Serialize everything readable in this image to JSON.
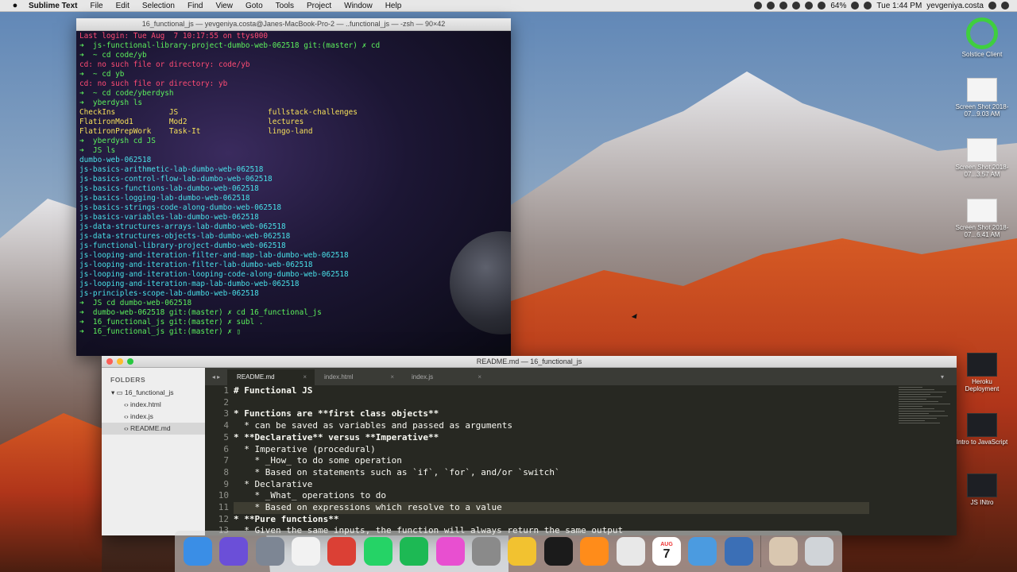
{
  "menubar": {
    "app": "Sublime Text",
    "items": [
      "File",
      "Edit",
      "Selection",
      "Find",
      "View",
      "Goto",
      "Tools",
      "Project",
      "Window",
      "Help"
    ],
    "battery": "64%",
    "clock": "Tue 1:44 PM",
    "user": "yevgeniya.costa"
  },
  "terminal": {
    "title": "16_functional_js — yevgeniya.costa@Janes-MacBook-Pro-2 — ..functional_js — -zsh — 90×42",
    "lines": [
      {
        "t": "Last login: Tue Aug  7 10:17:55 on ttys000",
        "c": "l-red"
      },
      {
        "t": "➜  js-functional-library-project-dumbo-web-062518 git:(master) ✗ cd",
        "c": "l-green"
      },
      {
        "t": "➜  ~ cd code/yb",
        "c": "l-green"
      },
      {
        "t": "cd: no such file or directory: code/yb",
        "c": "l-red"
      },
      {
        "t": "➜  ~ cd yb",
        "c": "l-green"
      },
      {
        "t": "cd: no such file or directory: yb",
        "c": "l-red"
      },
      {
        "t": "➜  ~ cd code/yberdysh",
        "c": "l-green"
      },
      {
        "t": "➜  yberdysh ls",
        "c": "l-green"
      },
      {
        "t": "CheckIns            JS                    fullstack-challenges",
        "c": "l-yel"
      },
      {
        "t": "FlatironMod1        Mod2                  lectures",
        "c": "l-yel"
      },
      {
        "t": "FlatironPrepWork    Task-It               lingo-land",
        "c": "l-yel"
      },
      {
        "t": "➜  yberdysh cd JS",
        "c": "l-green"
      },
      {
        "t": "➜  JS ls",
        "c": "l-green"
      },
      {
        "t": "dumbo-web-062518",
        "c": "l-cyan"
      },
      {
        "t": "js-basics-arithmetic-lab-dumbo-web-062518",
        "c": "l-cyan"
      },
      {
        "t": "js-basics-control-flow-lab-dumbo-web-062518",
        "c": "l-cyan"
      },
      {
        "t": "js-basics-functions-lab-dumbo-web-062518",
        "c": "l-cyan"
      },
      {
        "t": "js-basics-logging-lab-dumbo-web-062518",
        "c": "l-cyan"
      },
      {
        "t": "js-basics-strings-code-along-dumbo-web-062518",
        "c": "l-cyan"
      },
      {
        "t": "js-basics-variables-lab-dumbo-web-062518",
        "c": "l-cyan"
      },
      {
        "t": "js-data-structures-arrays-lab-dumbo-web-062518",
        "c": "l-cyan"
      },
      {
        "t": "js-data-structures-objects-lab-dumbo-web-062518",
        "c": "l-cyan"
      },
      {
        "t": "js-functional-library-project-dumbo-web-062518",
        "c": "l-cyan"
      },
      {
        "t": "js-looping-and-iteration-filter-and-map-lab-dumbo-web-062518",
        "c": "l-cyan"
      },
      {
        "t": "js-looping-and-iteration-filter-lab-dumbo-web-062518",
        "c": "l-cyan"
      },
      {
        "t": "js-looping-and-iteration-looping-code-along-dumbo-web-062518",
        "c": "l-cyan"
      },
      {
        "t": "js-looping-and-iteration-map-lab-dumbo-web-062518",
        "c": "l-cyan"
      },
      {
        "t": "js-principles-scope-lab-dumbo-web-062518",
        "c": "l-cyan"
      },
      {
        "t": "➜  JS cd dumbo-web-062518",
        "c": "l-green"
      },
      {
        "t": "➜  dumbo-web-062518 git:(master) ✗ cd 16_functional_js",
        "c": "l-green"
      },
      {
        "t": "➜  16_functional_js git:(master) ✗ subl .",
        "c": "l-green"
      },
      {
        "t": "➜  16_functional_js git:(master) ✗ ▯",
        "c": "l-green"
      }
    ]
  },
  "sublime": {
    "title": "README.md — 16_functional_js",
    "sidebar": {
      "header": "FOLDERS",
      "folder": "16_functional_js",
      "files": [
        "index.html",
        "index.js",
        "README.md"
      ]
    },
    "tabs": [
      {
        "label": "README.md",
        "close": "×"
      },
      {
        "label": "index.html",
        "close": "×"
      },
      {
        "label": "index.js",
        "close": "×"
      }
    ],
    "tab_nav": "◂ ▸",
    "line_numbers": [
      "1",
      "2",
      "3",
      "4",
      "5",
      "6",
      "7",
      "8",
      "9",
      "10",
      "11",
      "12",
      "13"
    ],
    "code_lines": [
      "# Functional JS",
      "",
      "* Functions are **first class objects**",
      "  * can be saved as variables and passed as arguments",
      "* **Declarative** versus **Imperative**",
      "  * Imperative (procedural)",
      "    * _How_ to do some operation",
      "    * Based on statements such as `if`, `for`, and/or `switch`",
      "  * Declarative",
      "    * _What_ operations to do",
      "    * Based on expressions which resolve to a value",
      "* **Pure functions**",
      "  * Given the same inputs, the function will always return the same output"
    ]
  },
  "desktop_icons": [
    {
      "label": "Solstice Client"
    },
    {
      "label": "Screen Shot 2018-07...9.03 AM"
    },
    {
      "label": "Screen Shot 2018-07...3.57 AM"
    },
    {
      "label": "Screen Shot 2018-07...6.41 AM"
    },
    {
      "label": "Heroku Deployment"
    },
    {
      "label": "Intro to JavaScript"
    },
    {
      "label": "JS INtro"
    }
  ],
  "dock": [
    {
      "name": "finder",
      "color": "#3a8ee6"
    },
    {
      "name": "siri",
      "color": "#6b4fd8"
    },
    {
      "name": "launchpad",
      "color": "#7d8694"
    },
    {
      "name": "notes-list",
      "color": "#f2f2f2"
    },
    {
      "name": "todoist",
      "color": "#db4035"
    },
    {
      "name": "whatsapp",
      "color": "#25d366"
    },
    {
      "name": "spotify",
      "color": "#1db954"
    },
    {
      "name": "itunes",
      "color": "#e84fd0"
    },
    {
      "name": "system-preferences",
      "color": "#8a8a8a"
    },
    {
      "name": "chrome",
      "color": "#f2c230"
    },
    {
      "name": "terminal",
      "color": "#1b1b1b"
    },
    {
      "name": "sublime-text",
      "color": "#ff8c1a"
    },
    {
      "name": "slides",
      "color": "#e8e8e8"
    },
    {
      "name": "calendar",
      "color": "#ffffff"
    },
    {
      "name": "alfred",
      "color": "#4b9be0"
    },
    {
      "name": "quicktime",
      "color": "#3b6fb6"
    },
    {
      "name": "photo",
      "color": "#d9c7b0"
    },
    {
      "name": "trash",
      "color": "#d0d4d8"
    }
  ],
  "calendar": {
    "month": "AUG",
    "day": "7"
  }
}
